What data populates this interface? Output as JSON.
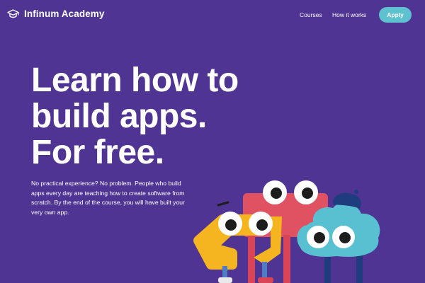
{
  "header": {
    "brand": "Infinum Academy",
    "logo_icon": "graduation-cap-icon",
    "nav": [
      {
        "label": "Courses"
      },
      {
        "label": "How it works"
      }
    ],
    "apply_label": "Apply"
  },
  "hero": {
    "title_lines": [
      "Learn how to",
      "build apps.",
      "For free."
    ],
    "description": "No practical experience? No problem. People who build apps every day are teaching how to create software from scratch. By the end of the course, you will have built your very own app."
  },
  "theme": {
    "background": "#4f3494",
    "accent": "#5ec1d0",
    "text": "#ffffff"
  },
  "illustration": {
    "characters": [
      "yellow-zigzag-character",
      "red-box-character",
      "blue-cloud-character"
    ]
  }
}
